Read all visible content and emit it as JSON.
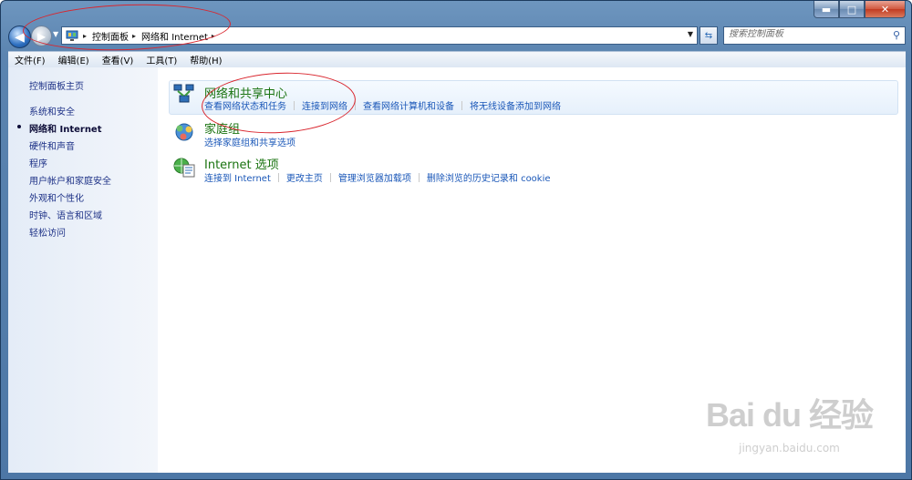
{
  "window": {
    "minimize_glyph": "▬",
    "maximize_glyph": "□",
    "close_glyph": "✕"
  },
  "navigation": {
    "back_glyph": "◀",
    "forward_glyph": "▶",
    "history_glyph": "▼",
    "address_icon": "control-panel-icon",
    "breadcrumbs": [
      "控制面板",
      "网络和 Internet"
    ],
    "separator_glyph": "▸",
    "dropdown_glyph": "▼",
    "refresh_glyph": "⇆",
    "search": {
      "placeholder": "搜索控制面板",
      "icon_glyph": "⚲"
    }
  },
  "menubar": {
    "items": [
      "文件(F)",
      "编辑(E)",
      "查看(V)",
      "工具(T)",
      "帮助(H)"
    ]
  },
  "sidebar": {
    "items": [
      {
        "label": "控制面板主页",
        "current": false
      },
      {
        "label": "系统和安全",
        "current": false
      },
      {
        "label": "网络和 Internet",
        "current": true
      },
      {
        "label": "硬件和声音",
        "current": false
      },
      {
        "label": "程序",
        "current": false
      },
      {
        "label": "用户帐户和家庭安全",
        "current": false
      },
      {
        "label": "外观和个性化",
        "current": false
      },
      {
        "label": "时钟、语言和区域",
        "current": false
      },
      {
        "label": "轻松访问",
        "current": false
      }
    ]
  },
  "categories": [
    {
      "title": "网络和共享中心",
      "icon": "network-sharing-icon",
      "links": [
        "查看网络状态和任务",
        "连接到网络",
        "查看网络计算机和设备",
        "将无线设备添加到网络"
      ]
    },
    {
      "title": "家庭组",
      "icon": "homegroup-icon",
      "links": [
        "选择家庭组和共享选项"
      ]
    },
    {
      "title": "Internet 选项",
      "icon": "internet-options-icon",
      "links": [
        "连接到 Internet",
        "更改主页",
        "管理浏览器加载项",
        "删除浏览的历史记录和 cookie"
      ]
    }
  ],
  "watermark": {
    "logo": "Bai du 经验",
    "url": "jingyan.baidu.com"
  },
  "colors": {
    "link": "#1a57b8",
    "category_title": "#1a7310",
    "annotation": "#d9262e",
    "frame": "#5b84b0"
  }
}
